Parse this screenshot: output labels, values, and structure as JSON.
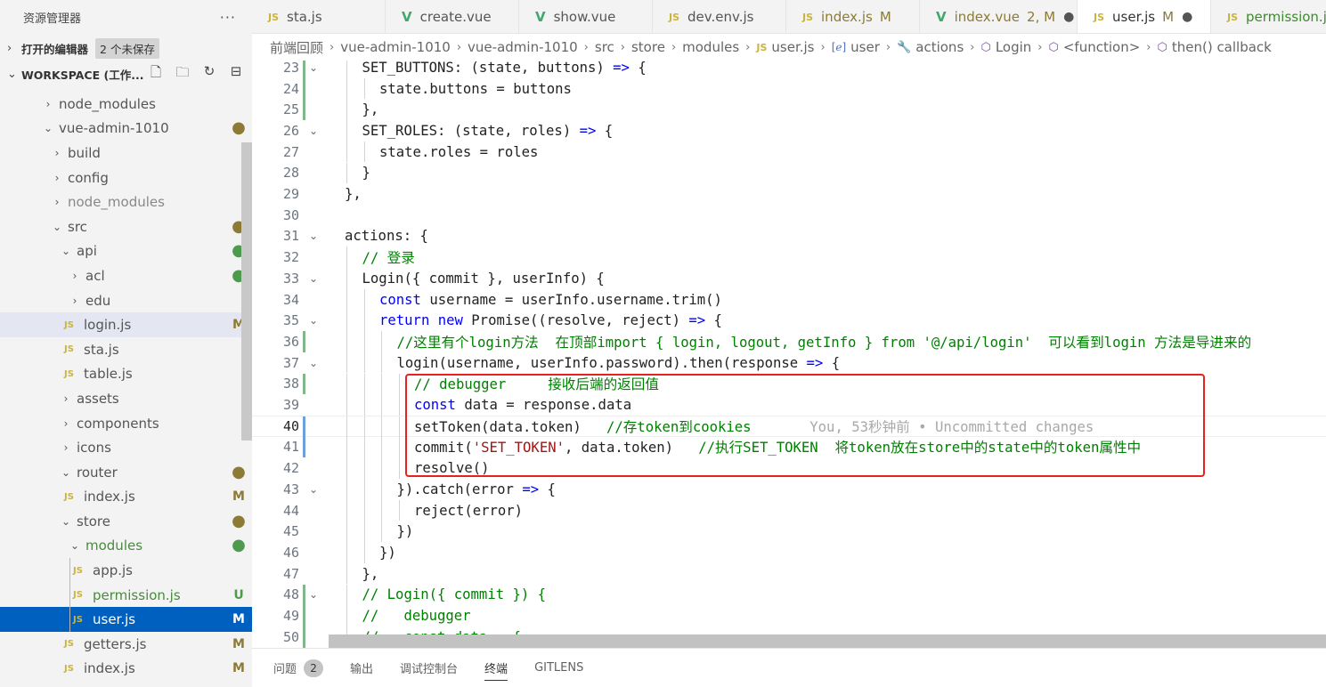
{
  "sidebar": {
    "title": "资源管理器",
    "more": "···",
    "open_editors": {
      "label": "打开的编辑器",
      "badge": "2 个未保存"
    },
    "workspace": {
      "label": "WORKSPACE (工作..."
    },
    "tree": [
      {
        "label": "node_modules",
        "kind": "folder-closed",
        "indent": 46,
        "status": "",
        "status_type": ""
      },
      {
        "label": "vue-admin-1010",
        "kind": "folder-open",
        "indent": 46,
        "status": "●",
        "status_type": "mod-dot"
      },
      {
        "label": "build",
        "kind": "folder-closed",
        "indent": 56,
        "status": "",
        "status_type": ""
      },
      {
        "label": "config",
        "kind": "folder-closed",
        "indent": 56,
        "status": "",
        "status_type": ""
      },
      {
        "label": "node_modules",
        "kind": "folder-closed",
        "indent": 56,
        "status": "",
        "status_type": "gray"
      },
      {
        "label": "src",
        "kind": "folder-open",
        "indent": 56,
        "status": "●",
        "status_type": "mod-dot"
      },
      {
        "label": "api",
        "kind": "folder-open",
        "indent": 66,
        "status": "●",
        "status_type": "untr-dot"
      },
      {
        "label": "acl",
        "kind": "folder-closed",
        "indent": 76,
        "status": "●",
        "status_type": "untr-dot"
      },
      {
        "label": "edu",
        "kind": "folder-closed",
        "indent": 76,
        "status": "",
        "status_type": ""
      },
      {
        "label": "login.js",
        "kind": "js",
        "indent": 72,
        "status": "M",
        "status_type": "mod",
        "hover": true
      },
      {
        "label": "sta.js",
        "kind": "js",
        "indent": 72,
        "status": "",
        "status_type": ""
      },
      {
        "label": "table.js",
        "kind": "js",
        "indent": 72,
        "status": "",
        "status_type": ""
      },
      {
        "label": "assets",
        "kind": "folder-closed",
        "indent": 66,
        "status": "",
        "status_type": ""
      },
      {
        "label": "components",
        "kind": "folder-closed",
        "indent": 66,
        "status": "",
        "status_type": ""
      },
      {
        "label": "icons",
        "kind": "folder-closed",
        "indent": 66,
        "status": "",
        "status_type": ""
      },
      {
        "label": "router",
        "kind": "folder-open",
        "indent": 66,
        "status": "●",
        "status_type": "mod-dot"
      },
      {
        "label": "index.js",
        "kind": "js",
        "indent": 72,
        "status": "M",
        "status_type": "mod"
      },
      {
        "label": "store",
        "kind": "folder-open",
        "indent": 66,
        "status": "●",
        "status_type": "mod-dot"
      },
      {
        "label": "modules",
        "kind": "folder-open",
        "indent": 76,
        "status": "●",
        "status_type": "untr-dot",
        "green": true
      },
      {
        "label": "app.js",
        "kind": "js",
        "indent": 82,
        "status": "",
        "status_type": ""
      },
      {
        "label": "permission.js",
        "kind": "js",
        "indent": 82,
        "status": "U",
        "status_type": "untr",
        "green": true
      },
      {
        "label": "user.js",
        "kind": "js",
        "indent": 82,
        "status": "M",
        "status_type": "mod",
        "selected": true
      },
      {
        "label": "getters.js",
        "kind": "js",
        "indent": 72,
        "status": "M",
        "status_type": "mod"
      },
      {
        "label": "index.js",
        "kind": "js",
        "indent": 72,
        "status": "M",
        "status_type": "mod"
      }
    ]
  },
  "tabs": [
    {
      "label": "sta.js",
      "icon": "JS",
      "type": "js",
      "mod": "",
      "dirty": false,
      "color": "",
      "width": 150
    },
    {
      "label": "create.vue",
      "icon": "V",
      "type": "vue",
      "mod": "",
      "dirty": false,
      "color": "",
      "width": 150
    },
    {
      "label": "show.vue",
      "icon": "V",
      "type": "vue",
      "mod": "",
      "dirty": false,
      "color": "",
      "width": 150
    },
    {
      "label": "dev.env.js",
      "icon": "JS",
      "type": "js",
      "mod": "",
      "dirty": false,
      "color": "",
      "width": 150
    },
    {
      "label": "index.js",
      "icon": "JS",
      "type": "js",
      "mod": "M",
      "dirty": false,
      "color": "olive",
      "width": 150
    },
    {
      "label": "index.vue",
      "icon": "V",
      "type": "vue",
      "mod": "2, M",
      "dirty": true,
      "color": "olive",
      "width": 177
    },
    {
      "label": "user.js",
      "icon": "JS",
      "type": "js",
      "mod": "M",
      "dirty": true,
      "color": "",
      "active": true,
      "width": 150
    },
    {
      "label": "permission.js",
      "icon": "JS",
      "type": "js",
      "mod": "",
      "dirty": false,
      "color": "green",
      "width": 130
    }
  ],
  "breadcrumb": [
    {
      "label": "前端回顾",
      "icon": ""
    },
    {
      "label": "vue-admin-1010",
      "icon": ""
    },
    {
      "label": "vue-admin-1010",
      "icon": ""
    },
    {
      "label": "src",
      "icon": ""
    },
    {
      "label": "store",
      "icon": ""
    },
    {
      "label": "modules",
      "icon": ""
    },
    {
      "label": "user.js",
      "icon": "JS"
    },
    {
      "label": "user",
      "icon": "[ℯ]"
    },
    {
      "label": "actions",
      "icon": "🔧"
    },
    {
      "label": "Login",
      "icon": "⬡"
    },
    {
      "label": "<function>",
      "icon": "⬡"
    },
    {
      "label": "then() callback",
      "icon": "⬡"
    }
  ],
  "editor": {
    "current_line": 40,
    "lines": [
      {
        "n": 23,
        "fold": "⌄",
        "gutter": "g",
        "ind": 1,
        "tokens": [
          [
            "SET_BUTTONS: (state, buttons) ",
            ""
          ],
          [
            "=>",
            "kw"
          ],
          [
            " {",
            ""
          ]
        ]
      },
      {
        "n": 24,
        "fold": "",
        "gutter": "g",
        "ind": 2,
        "tokens": [
          [
            "state.buttons = buttons",
            ""
          ]
        ]
      },
      {
        "n": 25,
        "fold": "",
        "gutter": "g",
        "ind": 1,
        "tokens": [
          [
            "},",
            ""
          ]
        ]
      },
      {
        "n": 26,
        "fold": "⌄",
        "gutter": "",
        "ind": 1,
        "tokens": [
          [
            "SET_ROLES: (state, roles) ",
            ""
          ],
          [
            "=>",
            "kw"
          ],
          [
            " {",
            ""
          ]
        ]
      },
      {
        "n": 27,
        "fold": "",
        "gutter": "",
        "ind": 2,
        "tokens": [
          [
            "state.roles = roles",
            ""
          ]
        ]
      },
      {
        "n": 28,
        "fold": "",
        "gutter": "",
        "ind": 1,
        "tokens": [
          [
            "}",
            ""
          ]
        ]
      },
      {
        "n": 29,
        "fold": "",
        "gutter": "",
        "ind": 0,
        "tokens": [
          [
            "},",
            ""
          ]
        ]
      },
      {
        "n": 30,
        "fold": "",
        "gutter": "",
        "ind": 0,
        "tokens": []
      },
      {
        "n": 31,
        "fold": "⌄",
        "gutter": "",
        "ind": 0,
        "tokens": [
          [
            "actions: {",
            ""
          ]
        ]
      },
      {
        "n": 32,
        "fold": "",
        "gutter": "",
        "ind": 1,
        "tokens": [
          [
            "// 登录",
            "cm"
          ]
        ]
      },
      {
        "n": 33,
        "fold": "⌄",
        "gutter": "",
        "ind": 1,
        "tokens": [
          [
            "Login({ commit }, userInfo) {",
            ""
          ]
        ]
      },
      {
        "n": 34,
        "fold": "",
        "gutter": "",
        "ind": 2,
        "tokens": [
          [
            "const",
            "kw"
          ],
          [
            " username = userInfo.username.trim()",
            ""
          ]
        ]
      },
      {
        "n": 35,
        "fold": "⌄",
        "gutter": "",
        "ind": 2,
        "tokens": [
          [
            "return",
            "kw"
          ],
          [
            " ",
            ""
          ],
          [
            "new",
            "kw"
          ],
          [
            " Promise((resolve, reject) ",
            ""
          ],
          [
            "=>",
            "kw"
          ],
          [
            " {",
            ""
          ]
        ]
      },
      {
        "n": 36,
        "fold": "",
        "gutter": "g",
        "ind": 3,
        "tokens": [
          [
            "//这里有个login方法  在顶部import { login, logout, getInfo } from '@/api/login'  可以看到login 方法是导进来的",
            "cm"
          ]
        ]
      },
      {
        "n": 37,
        "fold": "⌄",
        "gutter": "",
        "ind": 3,
        "tokens": [
          [
            "login(username, userInfo.password).then(response ",
            ""
          ],
          [
            "=>",
            "kw"
          ],
          [
            " {",
            ""
          ]
        ]
      },
      {
        "n": 38,
        "fold": "",
        "gutter": "g",
        "ind": 4,
        "tokens": [
          [
            "// debugger     接收后端的返回值",
            "cm"
          ]
        ]
      },
      {
        "n": 39,
        "fold": "",
        "gutter": "",
        "ind": 4,
        "tokens": [
          [
            "const",
            "kw"
          ],
          [
            " data = response.data",
            ""
          ]
        ]
      },
      {
        "n": 40,
        "fold": "",
        "gutter": "b",
        "ind": 4,
        "tokens": [
          [
            "setToken(data.token)   ",
            ""
          ],
          [
            "//存token到cookies",
            "cm"
          ],
          [
            "       You, 53秒钟前 • Uncommitted changes",
            "blame"
          ]
        ]
      },
      {
        "n": 41,
        "fold": "",
        "gutter": "b",
        "ind": 4,
        "tokens": [
          [
            "commit(",
            ""
          ],
          [
            "'SET_TOKEN'",
            "str"
          ],
          [
            ", data.token)   ",
            ""
          ],
          [
            "//执行SET_TOKEN  将token放在store中的state中的token属性中",
            "cm"
          ]
        ]
      },
      {
        "n": 42,
        "fold": "",
        "gutter": "",
        "ind": 4,
        "tokens": [
          [
            "resolve()",
            ""
          ]
        ]
      },
      {
        "n": 43,
        "fold": "⌄",
        "gutter": "",
        "ind": 3,
        "tokens": [
          [
            "}).catch(error ",
            ""
          ],
          [
            "=>",
            "kw"
          ],
          [
            " {",
            ""
          ]
        ]
      },
      {
        "n": 44,
        "fold": "",
        "gutter": "",
        "ind": 4,
        "tokens": [
          [
            "reject(error)",
            ""
          ]
        ]
      },
      {
        "n": 45,
        "fold": "",
        "gutter": "",
        "ind": 3,
        "tokens": [
          [
            "})",
            ""
          ]
        ]
      },
      {
        "n": 46,
        "fold": "",
        "gutter": "",
        "ind": 2,
        "tokens": [
          [
            "})",
            ""
          ]
        ]
      },
      {
        "n": 47,
        "fold": "",
        "gutter": "",
        "ind": 1,
        "tokens": [
          [
            "},",
            ""
          ]
        ]
      },
      {
        "n": 48,
        "fold": "⌄",
        "gutter": "g",
        "ind": 1,
        "tokens": [
          [
            "// Login({ commit }) {",
            "cm"
          ]
        ]
      },
      {
        "n": 49,
        "fold": "",
        "gutter": "g",
        "ind": 1,
        "tokens": [
          [
            "//   debugger",
            "cm"
          ]
        ]
      },
      {
        "n": 50,
        "fold": "",
        "gutter": "g",
        "ind": 1,
        "tokens": [
          [
            "//   const data = {",
            "cm"
          ]
        ]
      }
    ]
  },
  "panel": {
    "tabs": [
      {
        "label": "问题",
        "badge": "2"
      },
      {
        "label": "输出",
        "badge": ""
      },
      {
        "label": "调试控制台",
        "badge": ""
      },
      {
        "label": "终端",
        "badge": "",
        "active": true
      },
      {
        "label": "GITLENS",
        "badge": ""
      }
    ]
  },
  "colors": {
    "selection": "#0060c0",
    "highlight_box": "#e8211d",
    "modified": "#8d7a35",
    "untracked": "#4e9a4e"
  }
}
